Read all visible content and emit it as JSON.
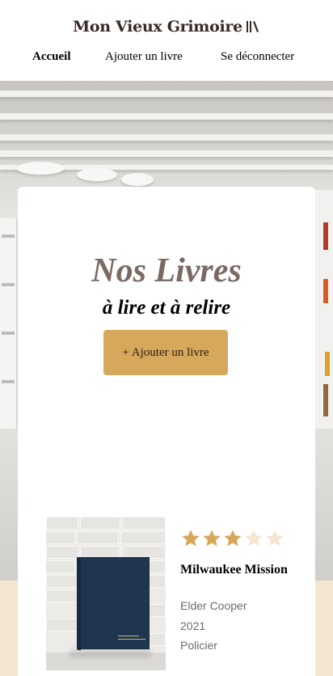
{
  "header": {
    "logo_text": "Mon Vieux Grimoire",
    "logo_icon": "books-icon"
  },
  "nav": {
    "items": [
      {
        "label": "Accueil",
        "active": true
      },
      {
        "label": "Ajouter un livre",
        "active": false
      },
      {
        "label": "Se déconnecter",
        "active": false
      }
    ]
  },
  "main": {
    "title": "Nos Livres",
    "subtitle": "à lire et à relire",
    "add_button_label": "+ Ajouter un livre"
  },
  "books": [
    {
      "title": "Milwaukee Mission",
      "author": "Elder Cooper",
      "year": "2021",
      "genre": "Policier",
      "rating": 3,
      "rating_max": 5
    }
  ],
  "colors": {
    "accent": "#d6a85c",
    "title_brown": "#7a6a62",
    "beige_band": "#f4e6d0",
    "star_filled": "#d6a85c",
    "star_empty": "#f6e6d0"
  }
}
